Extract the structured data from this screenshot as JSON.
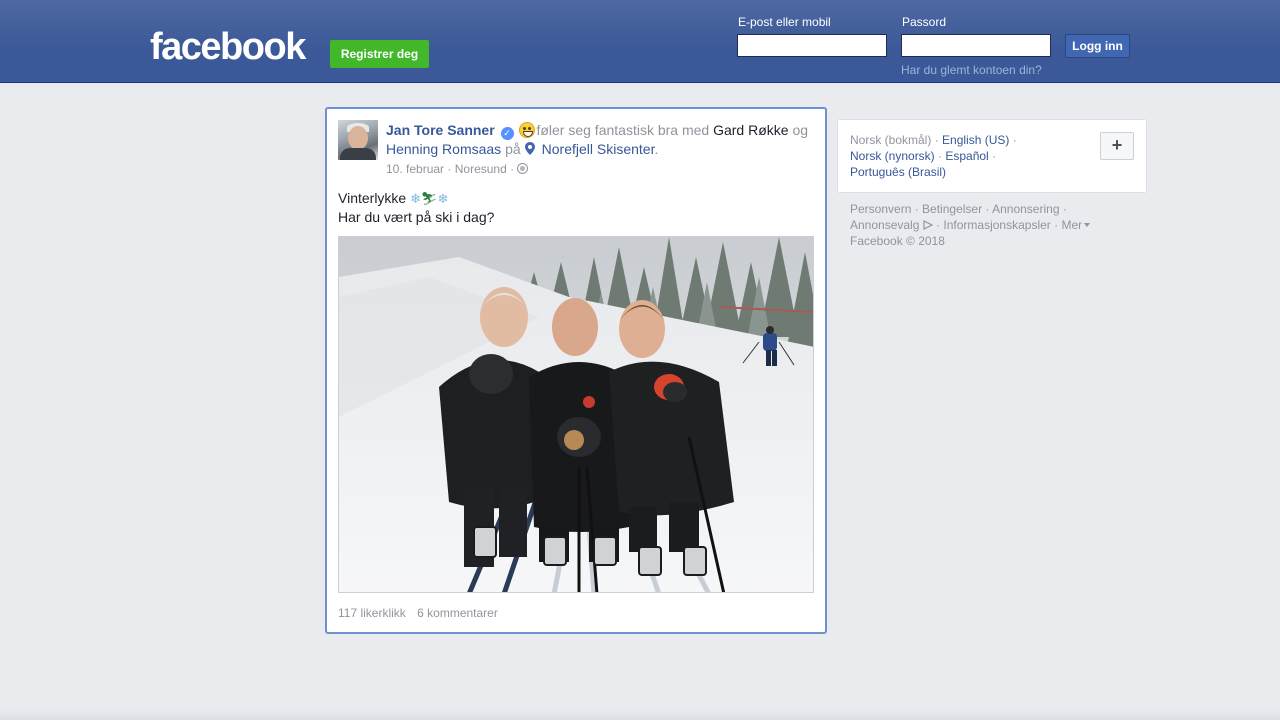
{
  "topbar": {
    "logo": "facebook",
    "register_label": "Registrer deg",
    "email_label": "E-post eller mobil",
    "email_value": "",
    "password_label": "Passord",
    "password_value": "",
    "login_label": "Logg inn",
    "forgot_link": "Har du glemt kontoen din?"
  },
  "post": {
    "author": "Jan Tore Sanner",
    "feeling_text": "føler seg fantastisk bra med",
    "tagged_1": "Gard Røkke",
    "and_text": "og",
    "tagged_2": "Henning Romsaas",
    "at_text": "på",
    "place": "Norefjell Skisenter",
    "place_suffix": ".",
    "date": "10. februar",
    "location": "Noresund",
    "meta_sep": "·",
    "status_line1": "Vinterlykke",
    "status_line2": "Har du vært på ski i dag?",
    "likes": "117 likerklikk",
    "comments": "6 kommentarer"
  },
  "languages": {
    "current": "Norsk (bokmål)",
    "items": [
      "English (US)",
      "Norsk (nynorsk)",
      "Español",
      "Português (Brasil)"
    ],
    "add_label": "+"
  },
  "footer": {
    "links": [
      "Personvern",
      "Betingelser",
      "Annonsering",
      "Annonsevalg",
      "Informasjonskapsler",
      "Mer"
    ],
    "copyright": "Facebook © 2018"
  },
  "colors": {
    "brand": "#3b5998",
    "register_green": "#42b72a",
    "link": "#365899"
  }
}
